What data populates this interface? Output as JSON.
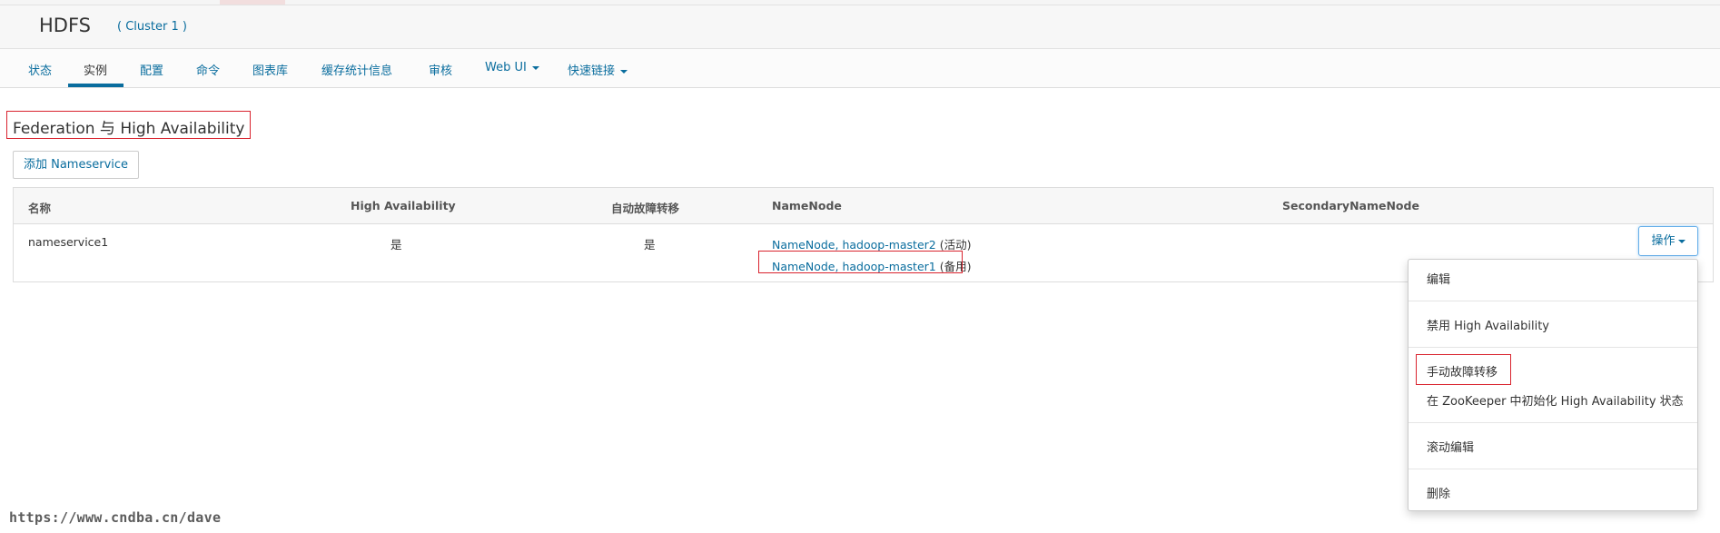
{
  "header": {
    "title": "HDFS",
    "cluster": "( Cluster 1 )"
  },
  "tabs": [
    {
      "label": "状态"
    },
    {
      "label": "实例",
      "active": true
    },
    {
      "label": "配置"
    },
    {
      "label": "命令"
    },
    {
      "label": "图表库"
    },
    {
      "label": "缓存统计信息"
    },
    {
      "label": "审核"
    },
    {
      "label": "Web UI",
      "dropdown": true
    },
    {
      "label": "快速链接",
      "dropdown": true
    }
  ],
  "section": {
    "title": "Federation 与 High Availability",
    "add_button": "添加 Nameservice"
  },
  "table": {
    "headers": [
      "名称",
      "High Availability",
      "自动故障转移",
      "NameNode",
      "SecondaryNameNode"
    ],
    "row": {
      "name": "nameservice1",
      "ha": "是",
      "auto_failover": "是",
      "namenode1_link": "NameNode, hadoop-master2",
      "namenode1_state": "(活动)",
      "namenode2_link": "NameNode, hadoop-master1",
      "namenode2_state": "(备用)"
    }
  },
  "actions": {
    "button": "操作",
    "menu": [
      "编辑",
      "禁用 High Availability",
      "手动故障转移",
      "在 ZooKeeper 中初始化 High Availability 状态",
      "滚动编辑",
      "删除"
    ]
  },
  "watermark": "https://www.cndba.cn/dave",
  "colors": {
    "link": "#0a6d9e",
    "highlight_box": "#d9232e"
  }
}
